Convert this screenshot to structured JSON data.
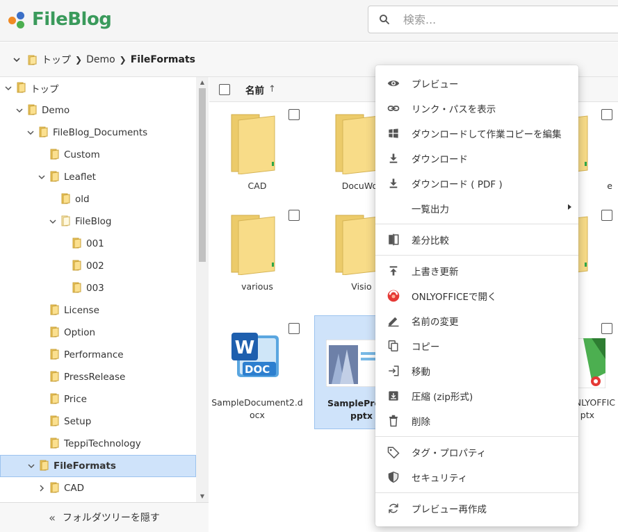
{
  "header": {
    "logo_text": "FileBlog",
    "search_placeholder": "検索...",
    "colors": {
      "logo_green": "#3a9a5b",
      "dot_orange": "#f08a24",
      "dot_blue": "#3b6fc7",
      "dot_green": "#4caf50"
    }
  },
  "breadcrumb": {
    "items": [
      "トップ",
      "Demo",
      "FileFormats"
    ]
  },
  "tree": {
    "items": [
      {
        "label": "トップ",
        "level": 0,
        "expanded": true
      },
      {
        "label": "Demo",
        "level": 1,
        "expanded": true
      },
      {
        "label": "FileBlog_Documents",
        "level": 2,
        "expanded": true
      },
      {
        "label": "Custom",
        "level": 3
      },
      {
        "label": "Leaflet",
        "level": 3,
        "expanded": true
      },
      {
        "label": "old",
        "level": 4
      },
      {
        "label": "FileBlog",
        "level": 4,
        "expanded": true,
        "open_folder": true
      },
      {
        "label": "001",
        "level": 5
      },
      {
        "label": "002",
        "level": 5
      },
      {
        "label": "003",
        "level": 5
      },
      {
        "label": "License",
        "level": 3
      },
      {
        "label": "Option",
        "level": 3
      },
      {
        "label": "Performance",
        "level": 3
      },
      {
        "label": "PressRelease",
        "level": 3
      },
      {
        "label": "Price",
        "level": 3
      },
      {
        "label": "Setup",
        "level": 3
      },
      {
        "label": "TeppiTechnology",
        "level": 3
      },
      {
        "label": "FileFormats",
        "level": 2,
        "expanded": true,
        "selected": true
      },
      {
        "label": "CAD",
        "level": 3,
        "collapsed": true
      }
    ],
    "hide_label": "フォルダツリーを隠す"
  },
  "main": {
    "column_name": "名前",
    "tiles": [
      {
        "name": "CAD",
        "kind": "folder"
      },
      {
        "name": "DocuWor",
        "kind": "folder"
      },
      {
        "name": "various",
        "kind": "folder"
      },
      {
        "name": "Visio",
        "kind": "folder"
      },
      {
        "name": "SampleDocument2.docx",
        "line1": "SampleDocument2.d",
        "line2": "ocx",
        "kind": "doc",
        "doc_label": "DOC"
      },
      {
        "name": "SamplePresentation.pptx",
        "line1": "SamplePreser",
        "line2": "pptx",
        "kind": "pptx",
        "selected": true
      },
      {
        "name": "e",
        "kind": "folder-partial"
      },
      {
        "name": "NLYOFFIC ptx",
        "line1": "NLYOFFIC",
        "line2": "ptx",
        "kind": "onlyoffice"
      }
    ]
  },
  "context_menu": {
    "items": [
      {
        "label": "プレビュー",
        "icon": "eye-icon"
      },
      {
        "label": "リンク・パスを表示",
        "icon": "link-icon"
      },
      {
        "label": "ダウンロードして作業コピーを編集",
        "icon": "windows-icon"
      },
      {
        "label": "ダウンロード",
        "icon": "download-icon"
      },
      {
        "label": "ダウンロード ( PDF )",
        "icon": "download-icon"
      },
      {
        "label": "一覧出力",
        "icon": "none",
        "submenu": true
      },
      {
        "label": "差分比較",
        "icon": "compare-icon"
      },
      {
        "label": "上書き更新",
        "icon": "upload-icon"
      },
      {
        "label": "ONLYOFFICEで開く",
        "icon": "onlyoffice-icon"
      },
      {
        "label": "名前の変更",
        "icon": "pencil-icon"
      },
      {
        "label": "コピー",
        "icon": "copy-icon"
      },
      {
        "label": "移動",
        "icon": "move-icon"
      },
      {
        "label": "圧縮 (zip形式)",
        "icon": "archive-icon"
      },
      {
        "label": "削除",
        "icon": "trash-icon"
      },
      {
        "label": "タグ・プロパティ",
        "icon": "tag-icon"
      },
      {
        "label": "セキュリティ",
        "icon": "shield-icon"
      },
      {
        "label": "プレビュー再作成",
        "icon": "refresh-icon"
      }
    ]
  }
}
